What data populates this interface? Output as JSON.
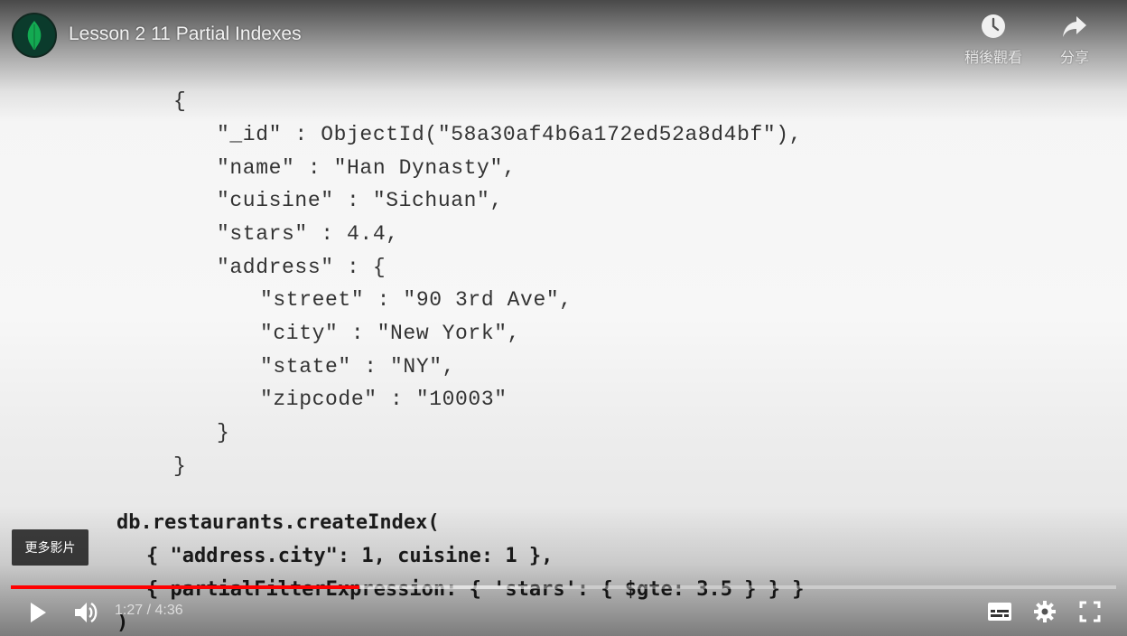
{
  "header": {
    "title": "Lesson 2 11 Partial Indexes",
    "watch_later_label": "稍後觀看",
    "share_label": "分享"
  },
  "slide": {
    "code_lines": [
      "{",
      "\"_id\" : ObjectId(\"58a30af4b6a172ed52a8d4bf\"),",
      "\"name\" : \"Han Dynasty\",",
      "\"cuisine\" : \"Sichuan\",",
      "\"stars\" : 4.4,",
      "\"address\" : {",
      "\"street\" : \"90 3rd Ave\",",
      "\"city\" : \"New York\",",
      "\"state\" : \"NY\",",
      "\"zipcode\" : \"10003\"",
      "}",
      "}"
    ],
    "command_lines": [
      "db.restaurants.createIndex(",
      "{ \"address.city\": 1, cuisine: 1 },",
      "{ partialFilterExpression: { 'stars': { $gte: 3.5 } } }",
      ")"
    ]
  },
  "overlay": {
    "more_videos_label": "更多影片"
  },
  "controls": {
    "current_time": "1:27",
    "duration": "4:36",
    "time_separator": " / ",
    "progress_played": 0.315,
    "progress_buffered": 0.47
  },
  "colors": {
    "progress_red": "#ff0000",
    "logo_green": "#13aa52",
    "avatar_bg": "#0b3b2c"
  },
  "icons": [
    "mongodb-leaf-icon",
    "clock-icon",
    "share-icon",
    "play-icon",
    "volume-icon",
    "subtitles-icon",
    "settings-icon",
    "fullscreen-icon"
  ]
}
